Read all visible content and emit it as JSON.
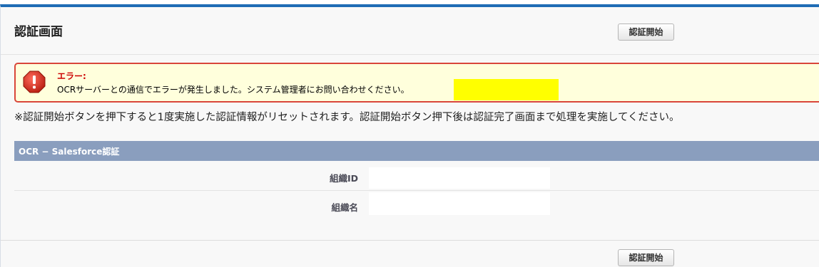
{
  "header": {
    "title": "認証画面",
    "start_button_label": "認証開始"
  },
  "error": {
    "title": "エラー:",
    "message": "OCRサーバーとの通信でエラーが発生しました。システム管理者にお問い合わせください。",
    "icon": "error-icon",
    "highlight_color": "#ffff00"
  },
  "notice": "※認証開始ボタンを押下すると1度実施した認証情報がリセットされます。認証開始ボタン押下後は認証完了画面まで処理を実施してください。",
  "section": {
    "title": "OCR − Salesforce認証",
    "fields": [
      {
        "label": "組織ID",
        "value": ""
      },
      {
        "label": "組織名",
        "value": ""
      }
    ]
  },
  "footer": {
    "start_button_label": "認証開始"
  },
  "colors": {
    "accent": "#1f6cb5",
    "error_border": "#d9463a",
    "section_bar": "#8a9ebe"
  }
}
